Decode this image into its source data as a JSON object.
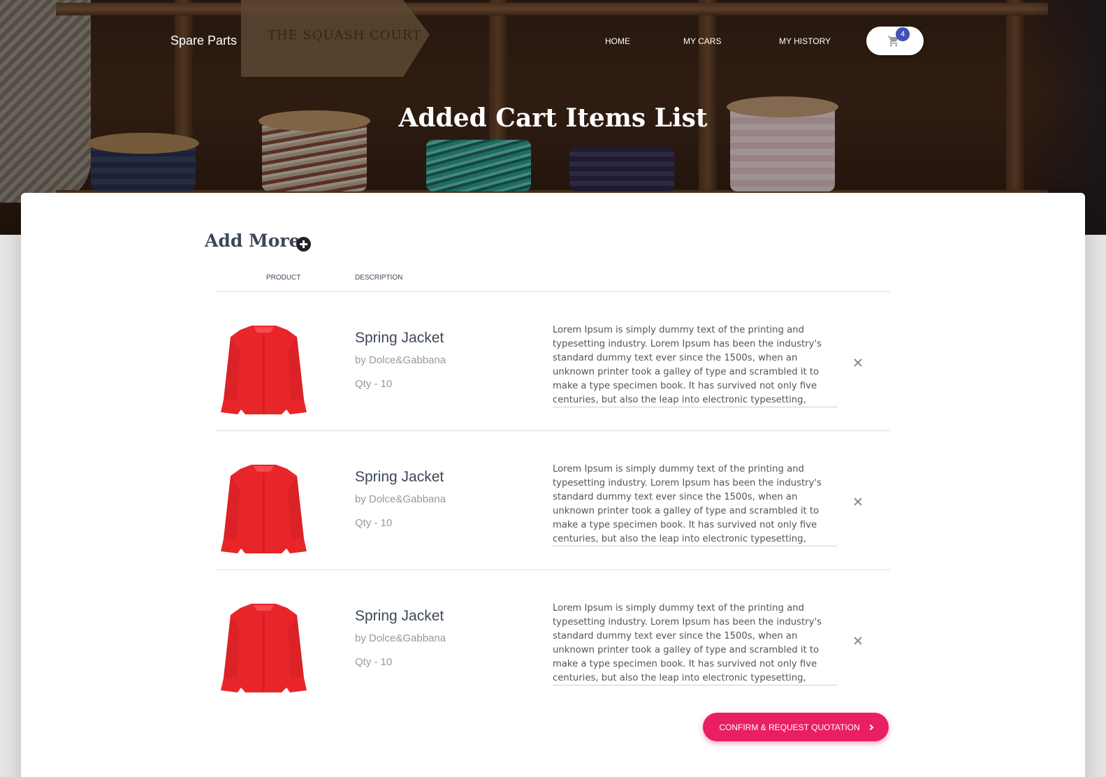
{
  "nav": {
    "brand": "Spare Parts",
    "links": [
      {
        "label": "HOME"
      },
      {
        "label": "MY CARS"
      },
      {
        "label": "MY HISTORY"
      }
    ],
    "cart_count": "4"
  },
  "hero": {
    "title": "Added Cart Items List",
    "tag_text": "THE SQUASH COURT"
  },
  "section": {
    "add_more": "Add More"
  },
  "table": {
    "headers": {
      "product": "PRODUCT",
      "description": "DESCRIPTION"
    },
    "rows": [
      {
        "name": "Spring Jacket",
        "brand": "by Dolce&Gabbana",
        "qty": "Qty - 10",
        "description": "Lorem Ipsum is simply dummy text of the printing and typesetting industry. Lorem Ipsum has been the industry's standard dummy text ever since the 1500s, when an unknown printer took a galley of type and scrambled it to make a type specimen book. It has survived not only five centuries, but also the leap into electronic typesetting, remaining essentially unchanged."
      },
      {
        "name": "Spring Jacket",
        "brand": "by Dolce&Gabbana",
        "qty": "Qty - 10",
        "description": "Lorem Ipsum is simply dummy text of the printing and typesetting industry. Lorem Ipsum has been the industry's standard dummy text ever since the 1500s, when an unknown printer took a galley of type and scrambled it to make a type specimen book. It has survived not only five centuries, but also the leap into electronic typesetting, remaining essentially unchanged."
      },
      {
        "name": "Spring Jacket",
        "brand": "by Dolce&Gabbana",
        "qty": "Qty - 10",
        "description": "Lorem Ipsum is simply dummy text of the printing and typesetting industry. Lorem Ipsum has been the industry's standard dummy text ever since the 1500s, when an unknown printer took a galley of type and scrambled it to make a type specimen book. It has survived not only five centuries, but also the leap into electronic typesetting, remaining essentially unchanged."
      }
    ]
  },
  "actions": {
    "confirm": "CONFIRM & REQUEST QUOTATION"
  },
  "colors": {
    "accent": "#e91e63",
    "badge": "#3f51b5",
    "product": "#e8262a"
  },
  "icons": {
    "cart": "shopping-cart-icon",
    "add": "plus-circle-icon",
    "remove": "close-icon",
    "confirm_arrow": "chevron-right-icon"
  }
}
